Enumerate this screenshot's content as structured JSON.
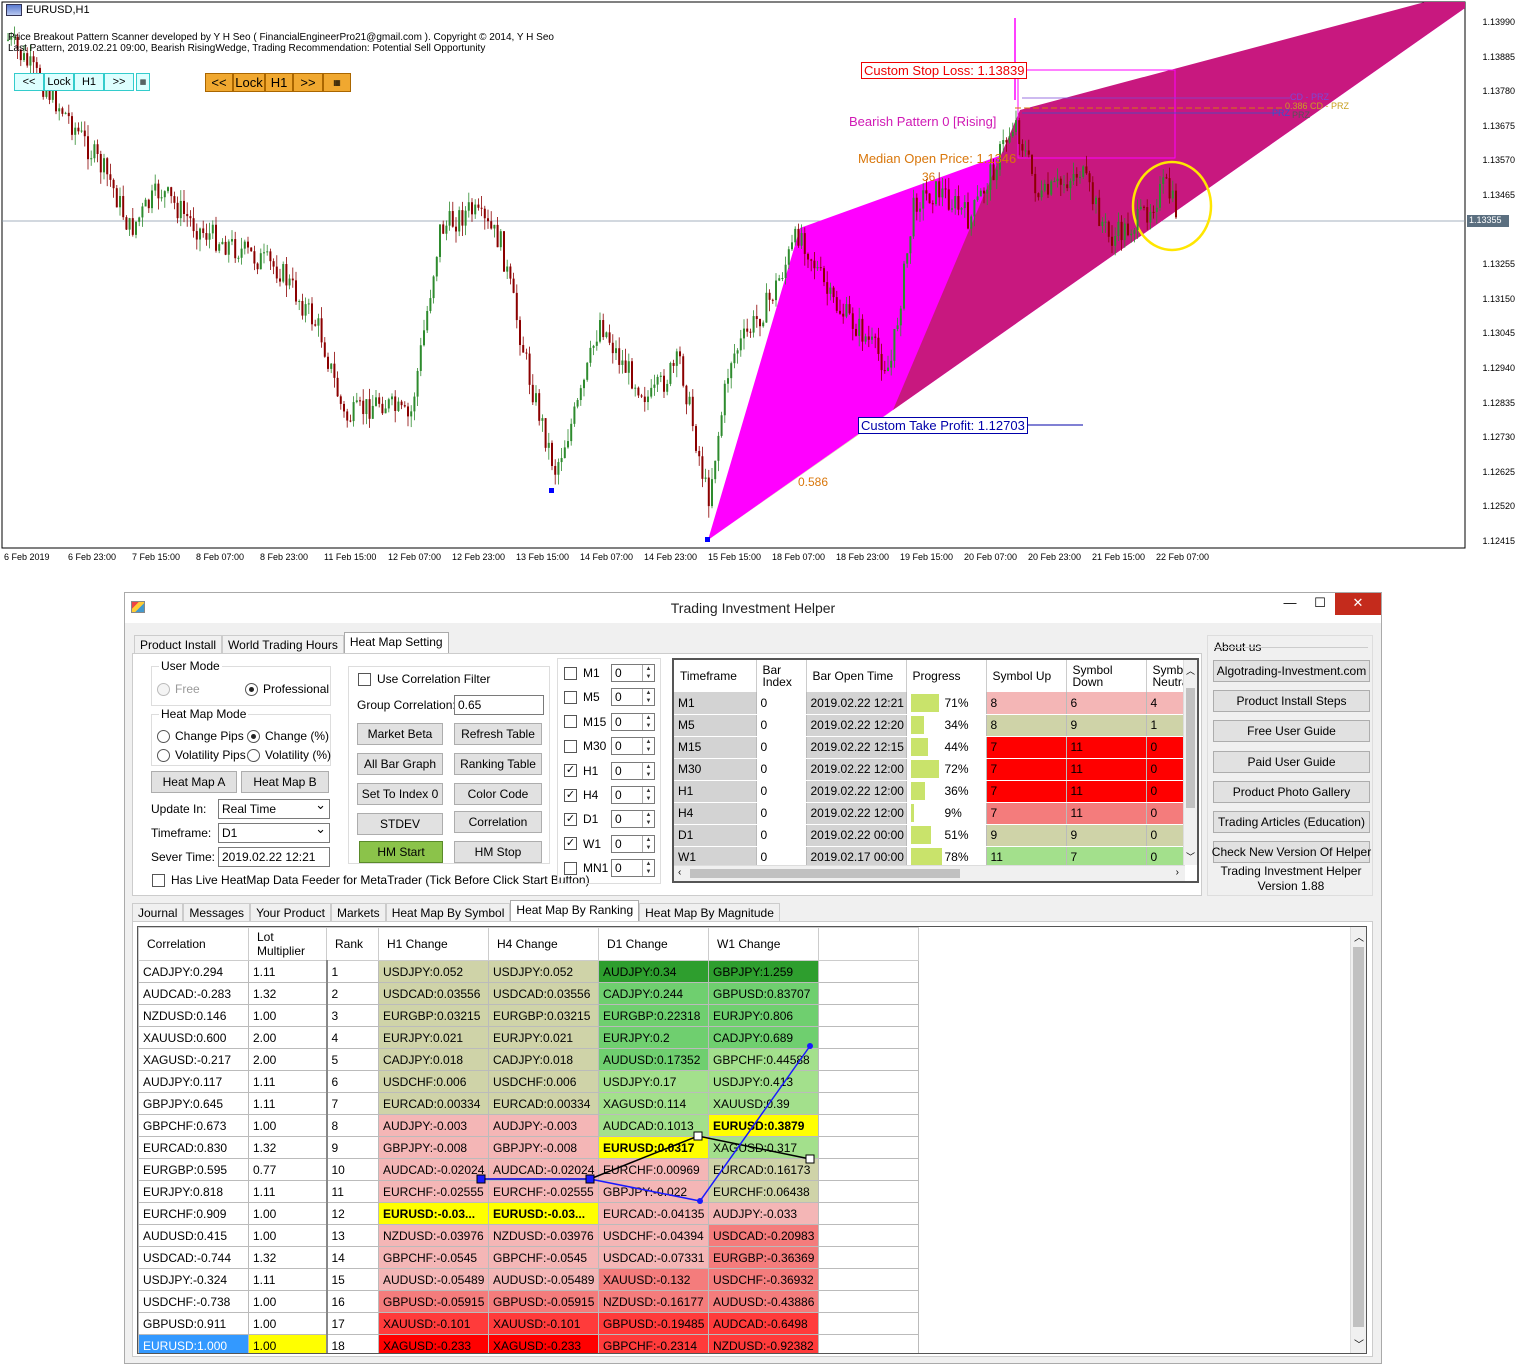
{
  "chart": {
    "title": "EURUSD,H1",
    "text_line1": "Price Breakout Pattern Scanner developed by Y H Seo ( FinancialEngineerPro21@gmail.com ). Copyright © 2014, Y H Seo",
    "text_line2": "Last Pattern, 2019.02.21 09:00, Bearish RisingWedge, Trading Recommendation: Potential Sell Opportunity",
    "nav1": [
      "<<",
      "Lock",
      "H1",
      ">>"
    ],
    "nav2": [
      "<<",
      "Lock",
      "H1",
      ">>"
    ],
    "price_axis": [
      "1.13990",
      "1.13885",
      "1.13780",
      "1.13675",
      "1.13570",
      "1.13465",
      "1.13355",
      "1.13255",
      "1.13150",
      "1.13045",
      "1.12940",
      "1.12835",
      "1.12730",
      "1.12625",
      "1.12520",
      "1.12415"
    ],
    "current_price": "1.13355",
    "date_axis": [
      "6 Feb 2019",
      "6 Feb 23:00",
      "7 Feb 15:00",
      "8 Feb 07:00",
      "8 Feb 23:00",
      "11 Feb 15:00",
      "12 Feb 07:00",
      "12 Feb 23:00",
      "13 Feb 15:00",
      "14 Feb 07:00",
      "14 Feb 23:00",
      "15 Feb 15:00",
      "18 Feb 07:00",
      "18 Feb 23:00",
      "19 Feb 15:00",
      "20 Feb 07:00",
      "20 Feb 23:00",
      "21 Feb 15:00",
      "22 Feb 07:00"
    ],
    "stop_loss": "Custom Stop Loss: 1.13839",
    "take_profit": "Custom Take Profit: 1.12703",
    "pattern_label": "Bearish Pattern 0  [Rising]",
    "median_open": "Median Open Price: 1.1346",
    "ratio_label": "0.586",
    "ratio_label2": "36",
    "prz_labels": [
      "CD - PRZ",
      "0.386 CD - PRZ",
      "PRZ",
      "PRZ"
    ],
    "colors": {
      "wedge_light": "#ff00ff",
      "wedge_dark": "#c8187f",
      "bull": "#2e8b2e",
      "bear": "#8b0000"
    }
  },
  "window": {
    "title": "Trading Investment Helper",
    "controls": [
      "—",
      "☐",
      "✕"
    ],
    "top_tabs": [
      "Product Install",
      "World Trading Hours",
      "Heat Map Setting"
    ],
    "user_mode": {
      "label": "User Mode",
      "free": "Free",
      "professional": "Professional"
    },
    "heat_map_mode": {
      "label": "Heat Map Mode",
      "change_pips": "Change Pips",
      "change_pct": "Change (%)",
      "vol_pips": "Volatility Pips",
      "vol_pct": "Volatility (%)"
    },
    "heat_map_a": "Heat Map A",
    "heat_map_b": "Heat Map B",
    "update_in_label": "Update In:",
    "update_in_value": "Real Time",
    "timeframe_label": "Timeframe:",
    "timeframe_value": "D1",
    "sever_time_label": "Sever Time:",
    "sever_time_value": "2019.02.22 12:21",
    "live_feeder": "Has Live HeatMap Data Feeder for MetaTrader (Tick Before Click Start Button)",
    "use_corr": "Use Correlation Filter",
    "group_corr_label": "Group Correlation:",
    "group_corr_value": "0.65",
    "buttons": [
      "Market Beta",
      "Refresh Table",
      "All Bar Graph",
      "Ranking Table",
      "Set To Index 0",
      "Color Code",
      "STDEV",
      "Correlation",
      "HM Start",
      "HM Stop"
    ],
    "tf_checks": [
      {
        "label": "M1",
        "checked": false,
        "value": "0"
      },
      {
        "label": "M5",
        "checked": false,
        "value": "0"
      },
      {
        "label": "M15",
        "checked": false,
        "value": "0"
      },
      {
        "label": "M30",
        "checked": false,
        "value": "0"
      },
      {
        "label": "H1",
        "checked": true,
        "value": "0"
      },
      {
        "label": "H4",
        "checked": true,
        "value": "0"
      },
      {
        "label": "D1",
        "checked": true,
        "value": "0"
      },
      {
        "label": "W1",
        "checked": true,
        "value": "0"
      },
      {
        "label": "MN1",
        "checked": false,
        "value": "0"
      }
    ],
    "status_table": {
      "headers": [
        "Timeframe",
        "Bar Index",
        "Bar Open Time",
        "Progress",
        "Symbol Up",
        "Symbol Down",
        "Symbol Neutral"
      ],
      "rows": [
        {
          "tf": "M1",
          "idx": "0",
          "time": "2019.02.22 12:21",
          "progress": 71,
          "pct": "71%",
          "up": "8",
          "down": "6",
          "neu": "4",
          "colors": [
            "#f4b6b6",
            "#f4b6b6",
            "#f4b6b6"
          ]
        },
        {
          "tf": "M5",
          "idx": "0",
          "time": "2019.02.22 12:20",
          "progress": 34,
          "pct": "34%",
          "up": "8",
          "down": "9",
          "neu": "1",
          "colors": [
            "#cfd3a8",
            "#cfd3a8",
            "#cfd3a8"
          ]
        },
        {
          "tf": "M15",
          "idx": "0",
          "time": "2019.02.22 12:15",
          "progress": 44,
          "pct": "44%",
          "up": "7",
          "down": "11",
          "neu": "0",
          "colors": [
            "#ff0000",
            "#ff0000",
            "#ff0000"
          ]
        },
        {
          "tf": "M30",
          "idx": "0",
          "time": "2019.02.22 12:00",
          "progress": 72,
          "pct": "72%",
          "up": "7",
          "down": "11",
          "neu": "0",
          "colors": [
            "#ff0000",
            "#ff0000",
            "#ff0000"
          ]
        },
        {
          "tf": "H1",
          "idx": "0",
          "time": "2019.02.22 12:00",
          "progress": 36,
          "pct": "36%",
          "up": "7",
          "down": "11",
          "neu": "0",
          "colors": [
            "#ff0000",
            "#ff0000",
            "#ff0000"
          ]
        },
        {
          "tf": "H4",
          "idx": "0",
          "time": "2019.02.22 12:00",
          "progress": 9,
          "pct": "9%",
          "up": "7",
          "down": "11",
          "neu": "0",
          "colors": [
            "#f47c7c",
            "#f47c7c",
            "#f47c7c"
          ]
        },
        {
          "tf": "D1",
          "idx": "0",
          "time": "2019.02.22 00:00",
          "progress": 51,
          "pct": "51%",
          "up": "9",
          "down": "9",
          "neu": "0",
          "colors": [
            "#cfd3a8",
            "#cfd3a8",
            "#cfd3a8"
          ]
        },
        {
          "tf": "W1",
          "idx": "0",
          "time": "2019.02.17 00:00",
          "progress": 78,
          "pct": "78%",
          "up": "11",
          "down": "7",
          "neu": "0",
          "colors": [
            "#a3e08c",
            "#a3e08c",
            "#a3e08c"
          ]
        }
      ]
    },
    "about": {
      "label": "About us",
      "buttons": [
        "Algotrading-Investment.com",
        "Product Install Steps",
        "Free User Guide",
        "Paid User Guide",
        "Product Photo Gallery",
        "Trading Articles (Education)",
        "Check New Version Of Helper"
      ],
      "product": "Trading Investment Helper",
      "version": "Version 1.88"
    },
    "bottom_tabs": [
      "Journal",
      "Messages",
      "Your Product",
      "Markets",
      "Heat Map By Symbol",
      "Heat Map By Ranking",
      "Heat Map By Magnitude"
    ],
    "heat_table": {
      "headers": [
        "Correlation",
        "Lot Multiplier",
        "Rank",
        "H1 Change",
        "H4 Change",
        "D1 Change",
        "W1 Change"
      ],
      "rows": [
        [
          "CADJPY:0.294",
          "1.11",
          "1",
          "USDJPY:0.052",
          "USDJPY:0.052",
          "AUDJPY:0.34",
          "GBPJPY:1.259"
        ],
        [
          "AUDCAD:-0.283",
          "1.32",
          "2",
          "USDCAD:0.03556",
          "USDCAD:0.03556",
          "CADJPY:0.244",
          "GBPUSD:0.83707"
        ],
        [
          "NZDUSD:0.146",
          "1.00",
          "3",
          "EURGBP:0.03215",
          "EURGBP:0.03215",
          "EURGBP:0.22318",
          "EURJPY:0.806"
        ],
        [
          "XAUUSD:0.600",
          "2.00",
          "4",
          "EURJPY:0.021",
          "EURJPY:0.021",
          "EURJPY:0.2",
          "CADJPY:0.689"
        ],
        [
          "XAGUSD:-0.217",
          "2.00",
          "5",
          "CADJPY:0.018",
          "CADJPY:0.018",
          "AUDUSD:0.17352",
          "GBPCHF:0.44588"
        ],
        [
          "AUDJPY:0.117",
          "1.11",
          "6",
          "USDCHF:0.006",
          "USDCHF:0.006",
          "USDJPY:0.17",
          "USDJPY:0.413"
        ],
        [
          "GBPJPY:0.645",
          "1.11",
          "7",
          "EURCAD:0.00334",
          "EURCAD:0.00334",
          "XAGUSD:0.114",
          "XAUUSD:0.39"
        ],
        [
          "GBPCHF:0.673",
          "1.00",
          "8",
          "AUDJPY:-0.003",
          "AUDJPY:-0.003",
          "AUDCAD:0.1013",
          "EURUSD:0.3879"
        ],
        [
          "EURCAD:0.830",
          "1.32",
          "9",
          "GBPJPY:-0.008",
          "GBPJPY:-0.008",
          "EURUSD:0.0317",
          "XAGUSD:0.317"
        ],
        [
          "EURGBP:0.595",
          "0.77",
          "10",
          "AUDCAD:-0.02024",
          "AUDCAD:-0.02024",
          "EURCHF:0.00969",
          "EURCAD:0.16173"
        ],
        [
          "EURJPY:0.818",
          "1.11",
          "11",
          "EURCHF:-0.02555",
          "EURCHF:-0.02555",
          "GBPJPY:-0.022",
          "EURCHF:0.06438"
        ],
        [
          "EURCHF:0.909",
          "1.00",
          "12",
          "EURUSD:-0.03...",
          "EURUSD:-0.03...",
          "EURCAD:-0.04135",
          "AUDJPY:-0.033"
        ],
        [
          "AUDUSD:0.415",
          "1.00",
          "13",
          "NZDUSD:-0.03976",
          "NZDUSD:-0.03976",
          "USDCHF:-0.04394",
          "USDCAD:-0.20983"
        ],
        [
          "USDCAD:-0.744",
          "1.32",
          "14",
          "GBPCHF:-0.0545",
          "GBPCHF:-0.0545",
          "USDCAD:-0.07331",
          "EURGBP:-0.36369"
        ],
        [
          "USDJPY:-0.324",
          "1.11",
          "15",
          "AUDUSD:-0.05489",
          "AUDUSD:-0.05489",
          "XAUUSD:-0.132",
          "USDCHF:-0.36932"
        ],
        [
          "USDCHF:-0.738",
          "1.00",
          "16",
          "GBPUSD:-0.05915",
          "GBPUSD:-0.05915",
          "NZDUSD:-0.16177",
          "AUDUSD:-0.43886"
        ],
        [
          "GBPUSD:0.911",
          "1.00",
          "17",
          "XAUUSD:-0.101",
          "XAUUSD:-0.101",
          "GBPUSD:-0.19485",
          "AUDCAD:-0.6498"
        ],
        [
          "EURUSD:1.000",
          "1.00",
          "18",
          "XAGUSD:-0.233",
          "XAGUSD:-0.233",
          "GBPCHF:-0.2314",
          "NZDUSD:-0.92382"
        ]
      ],
      "h_colors": [
        "#cfd3a8",
        "#cfd3a8",
        "#cfd3a8",
        "#cfd3a8",
        "#cfd3a8",
        "#cfd3a8",
        "#cfd3a8",
        "#f4b6b6",
        "#f4b6b6",
        "#f4b6b6",
        "#f4b6b6",
        "#ffff00",
        "#f4b6b6",
        "#f4b6b6",
        "#f4b6b6",
        "#f47c7c",
        "#ff3b3b",
        "#ff0000"
      ],
      "d1_colors": [
        "#2e9e2e",
        "#6fcf6f",
        "#6fcf6f",
        "#6fcf6f",
        "#6fcf6f",
        "#a3e08c",
        "#a3e08c",
        "#a3e08c",
        "#ffff00",
        "#f4b6b6",
        "#f4b6b6",
        "#f4b6b6",
        "#f4b6b6",
        "#f4b6b6",
        "#f47c7c",
        "#f47c7c",
        "#ff3b3b",
        "#ff3b3b"
      ],
      "w1_colors": [
        "#2e9e2e",
        "#6fcf6f",
        "#6fcf6f",
        "#6fcf6f",
        "#a3e08c",
        "#a3e08c",
        "#a3e08c",
        "#ffff00",
        "#a3e08c",
        "#cfd3a8",
        "#cfd3a8",
        "#f4b6b6",
        "#f47c7c",
        "#f47c7c",
        "#f47c7c",
        "#f47c7c",
        "#ff3b3b",
        "#ff3b3b"
      ]
    }
  }
}
